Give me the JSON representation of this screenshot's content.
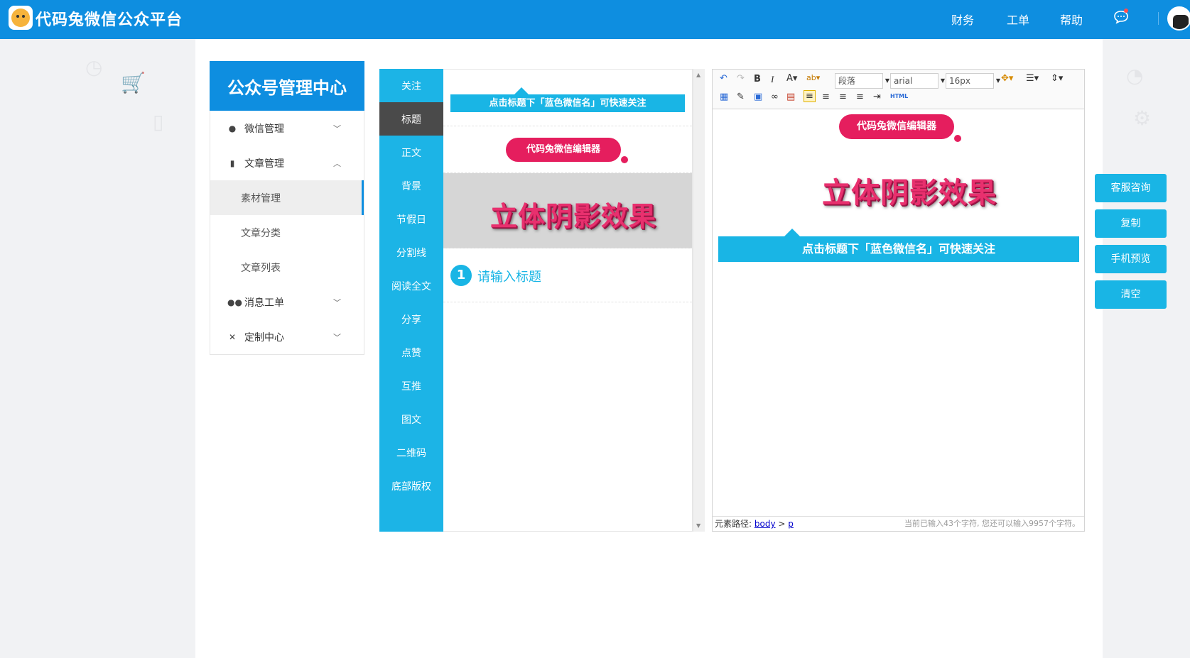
{
  "app": {
    "title": "代码兔微信公众平台"
  },
  "topnav": {
    "items": [
      "财务",
      "工单",
      "帮助"
    ]
  },
  "sidebar": {
    "title": "公众号管理中心",
    "menu": {
      "wechat": "微信管理",
      "article": "文章管理",
      "material": "素材管理",
      "category": "文章分类",
      "list": "文章列表",
      "ticket": "消息工单",
      "custom": "定制中心"
    }
  },
  "components": {
    "tabs": [
      "关注",
      "标题",
      "正文",
      "背景",
      "节假日",
      "分割线",
      "阅读全文",
      "分享",
      "点赞",
      "互推",
      "图文",
      "二维码",
      "底部版权"
    ],
    "active_tab": "标题",
    "tpl_follow": "点击标题下「蓝色微信名」可快速关注",
    "tpl_pill": "代码兔微信编辑器",
    "tpl_shadow": "立体阴影效果",
    "tpl_number": "1",
    "tpl_title": "请输入标题"
  },
  "editor": {
    "toolbar": {
      "paragraph": "段落",
      "font": "arial",
      "size": "16px",
      "html": "HTML"
    },
    "content": {
      "pill": "代码兔微信编辑器",
      "shadow": "立体阴影效果",
      "follow": "点击标题下「蓝色微信名」可快速关注"
    },
    "status": {
      "path_label": "元素路径:",
      "body": "body",
      "sep": ">",
      "p": "p",
      "count": "当前已输入43个字符, 您还可以输入9957个字符。"
    }
  },
  "actions": {
    "service": "客服咨询",
    "copy": "复制",
    "preview": "手机预览",
    "clear": "清空"
  },
  "colors": {
    "primary": "#0e8ee0",
    "cyan": "#19b5e5",
    "pink": "#e51e5e",
    "active_tab": "#4a4a4a"
  }
}
